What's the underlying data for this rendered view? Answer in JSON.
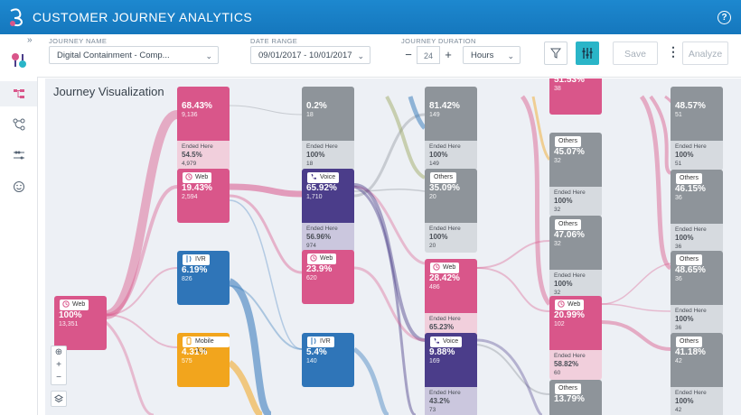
{
  "app": {
    "title": "CUSTOMER JOURNEY ANALYTICS",
    "help_icon": "question-circle-icon"
  },
  "filters": {
    "journey_name_label": "JOURNEY NAME",
    "journey_name_value": "Digital Containment - Comp...",
    "date_range_label": "DATE RANGE",
    "date_range_value": "09/01/2017 - 10/01/2017",
    "duration_label": "JOURNEY DURATION",
    "duration_value": "24",
    "duration_unit": "Hours",
    "save_label": "Save",
    "analyze_label": "Analyze"
  },
  "canvas": {
    "title": "Journey Visualization"
  },
  "colors": {
    "web": "#d9568a",
    "ivr": "#2f75b8",
    "voice": "#4b3d8a",
    "mobile": "#f2a51d",
    "others": "#8e949a"
  },
  "nodes": [
    {
      "id": "n1",
      "type": "web",
      "label": "Web",
      "pct": "100%",
      "count": "13,351",
      "ended": false
    },
    {
      "id": "n2",
      "type": "web",
      "label": "",
      "pct": "68.43%",
      "count": "9,136",
      "ended": true,
      "ended_label": "Ended Here",
      "ended_pct": "54.5%",
      "ended_count": "4,979"
    },
    {
      "id": "n3",
      "type": "web",
      "label": "Web",
      "pct": "19.43%",
      "count": "2,594",
      "ended": false
    },
    {
      "id": "n4",
      "type": "ivr",
      "label": "IVR",
      "pct": "6.19%",
      "count": "826",
      "ended": false
    },
    {
      "id": "n5",
      "type": "mobile",
      "label": "Mobile App",
      "pct": "4.31%",
      "count": "575",
      "ended": false
    },
    {
      "id": "n6",
      "type": "others",
      "label": "",
      "pct": "0.2%",
      "count": "18",
      "ended": true,
      "ended_label": "Ended Here",
      "ended_pct": "100%",
      "ended_count": "18"
    },
    {
      "id": "n7",
      "type": "voice",
      "label": "Voice",
      "pct": "65.92%",
      "count": "1,710",
      "ended": true,
      "ended_label": "Ended Here",
      "ended_pct": "56.96%",
      "ended_count": "974"
    },
    {
      "id": "n8",
      "type": "web",
      "label": "Web",
      "pct": "23.9%",
      "count": "620",
      "ended": false
    },
    {
      "id": "n9",
      "type": "ivr",
      "label": "IVR",
      "pct": "5.4%",
      "count": "140",
      "ended": false
    },
    {
      "id": "n10",
      "type": "others",
      "label": "",
      "pct": "81.42%",
      "count": "149",
      "ended": true,
      "ended_label": "Ended Here",
      "ended_pct": "100%",
      "ended_count": "149"
    },
    {
      "id": "n11",
      "type": "others",
      "label": "Others",
      "pct": "35.09%",
      "count": "20",
      "ended": true,
      "ended_label": "Ended Here",
      "ended_pct": "100%",
      "ended_count": "20"
    },
    {
      "id": "n12",
      "type": "web",
      "label": "Web",
      "pct": "28.42%",
      "count": "486",
      "ended": true,
      "ended_label": "Ended Here",
      "ended_pct": "65.23%",
      "ended_count": "317"
    },
    {
      "id": "n13",
      "type": "voice",
      "label": "Voice",
      "pct": "9.88%",
      "count": "169",
      "ended": true,
      "ended_label": "Ended Here",
      "ended_pct": "43.2%",
      "ended_count": "73"
    },
    {
      "id": "n14",
      "type": "web",
      "label": "",
      "pct": "51.53%",
      "count": "38",
      "ended": false
    },
    {
      "id": "n15",
      "type": "others",
      "label": "Others",
      "pct": "45.07%",
      "count": "32",
      "ended": true,
      "ended_label": "Ended Here",
      "ended_pct": "100%",
      "ended_count": "32"
    },
    {
      "id": "n16",
      "type": "others",
      "label": "Others",
      "pct": "47.06%",
      "count": "32",
      "ended": true,
      "ended_label": "Ended Here",
      "ended_pct": "100%",
      "ended_count": "32"
    },
    {
      "id": "n17",
      "type": "web",
      "label": "Web",
      "pct": "20.99%",
      "count": "102",
      "ended": true,
      "ended_label": "Ended Here",
      "ended_pct": "58.82%",
      "ended_count": "60"
    },
    {
      "id": "n18",
      "type": "others",
      "label": "Others",
      "pct": "13.79%",
      "count": "",
      "ended": false
    },
    {
      "id": "n19",
      "type": "others",
      "label": "",
      "pct": "48.57%",
      "count": "51",
      "ended": true,
      "ended_label": "Ended Here",
      "ended_pct": "100%",
      "ended_count": "51"
    },
    {
      "id": "n20",
      "type": "others",
      "label": "Others",
      "pct": "46.15%",
      "count": "36",
      "ended": true,
      "ended_label": "Ended Here",
      "ended_pct": "100%",
      "ended_count": "36"
    },
    {
      "id": "n21",
      "type": "others",
      "label": "Others",
      "pct": "48.65%",
      "count": "36",
      "ended": true,
      "ended_label": "Ended Here",
      "ended_pct": "100%",
      "ended_count": "36"
    },
    {
      "id": "n22",
      "type": "others",
      "label": "Others",
      "pct": "41.18%",
      "count": "42",
      "ended": true,
      "ended_label": "Ended Here",
      "ended_pct": "100%",
      "ended_count": "42"
    }
  ]
}
